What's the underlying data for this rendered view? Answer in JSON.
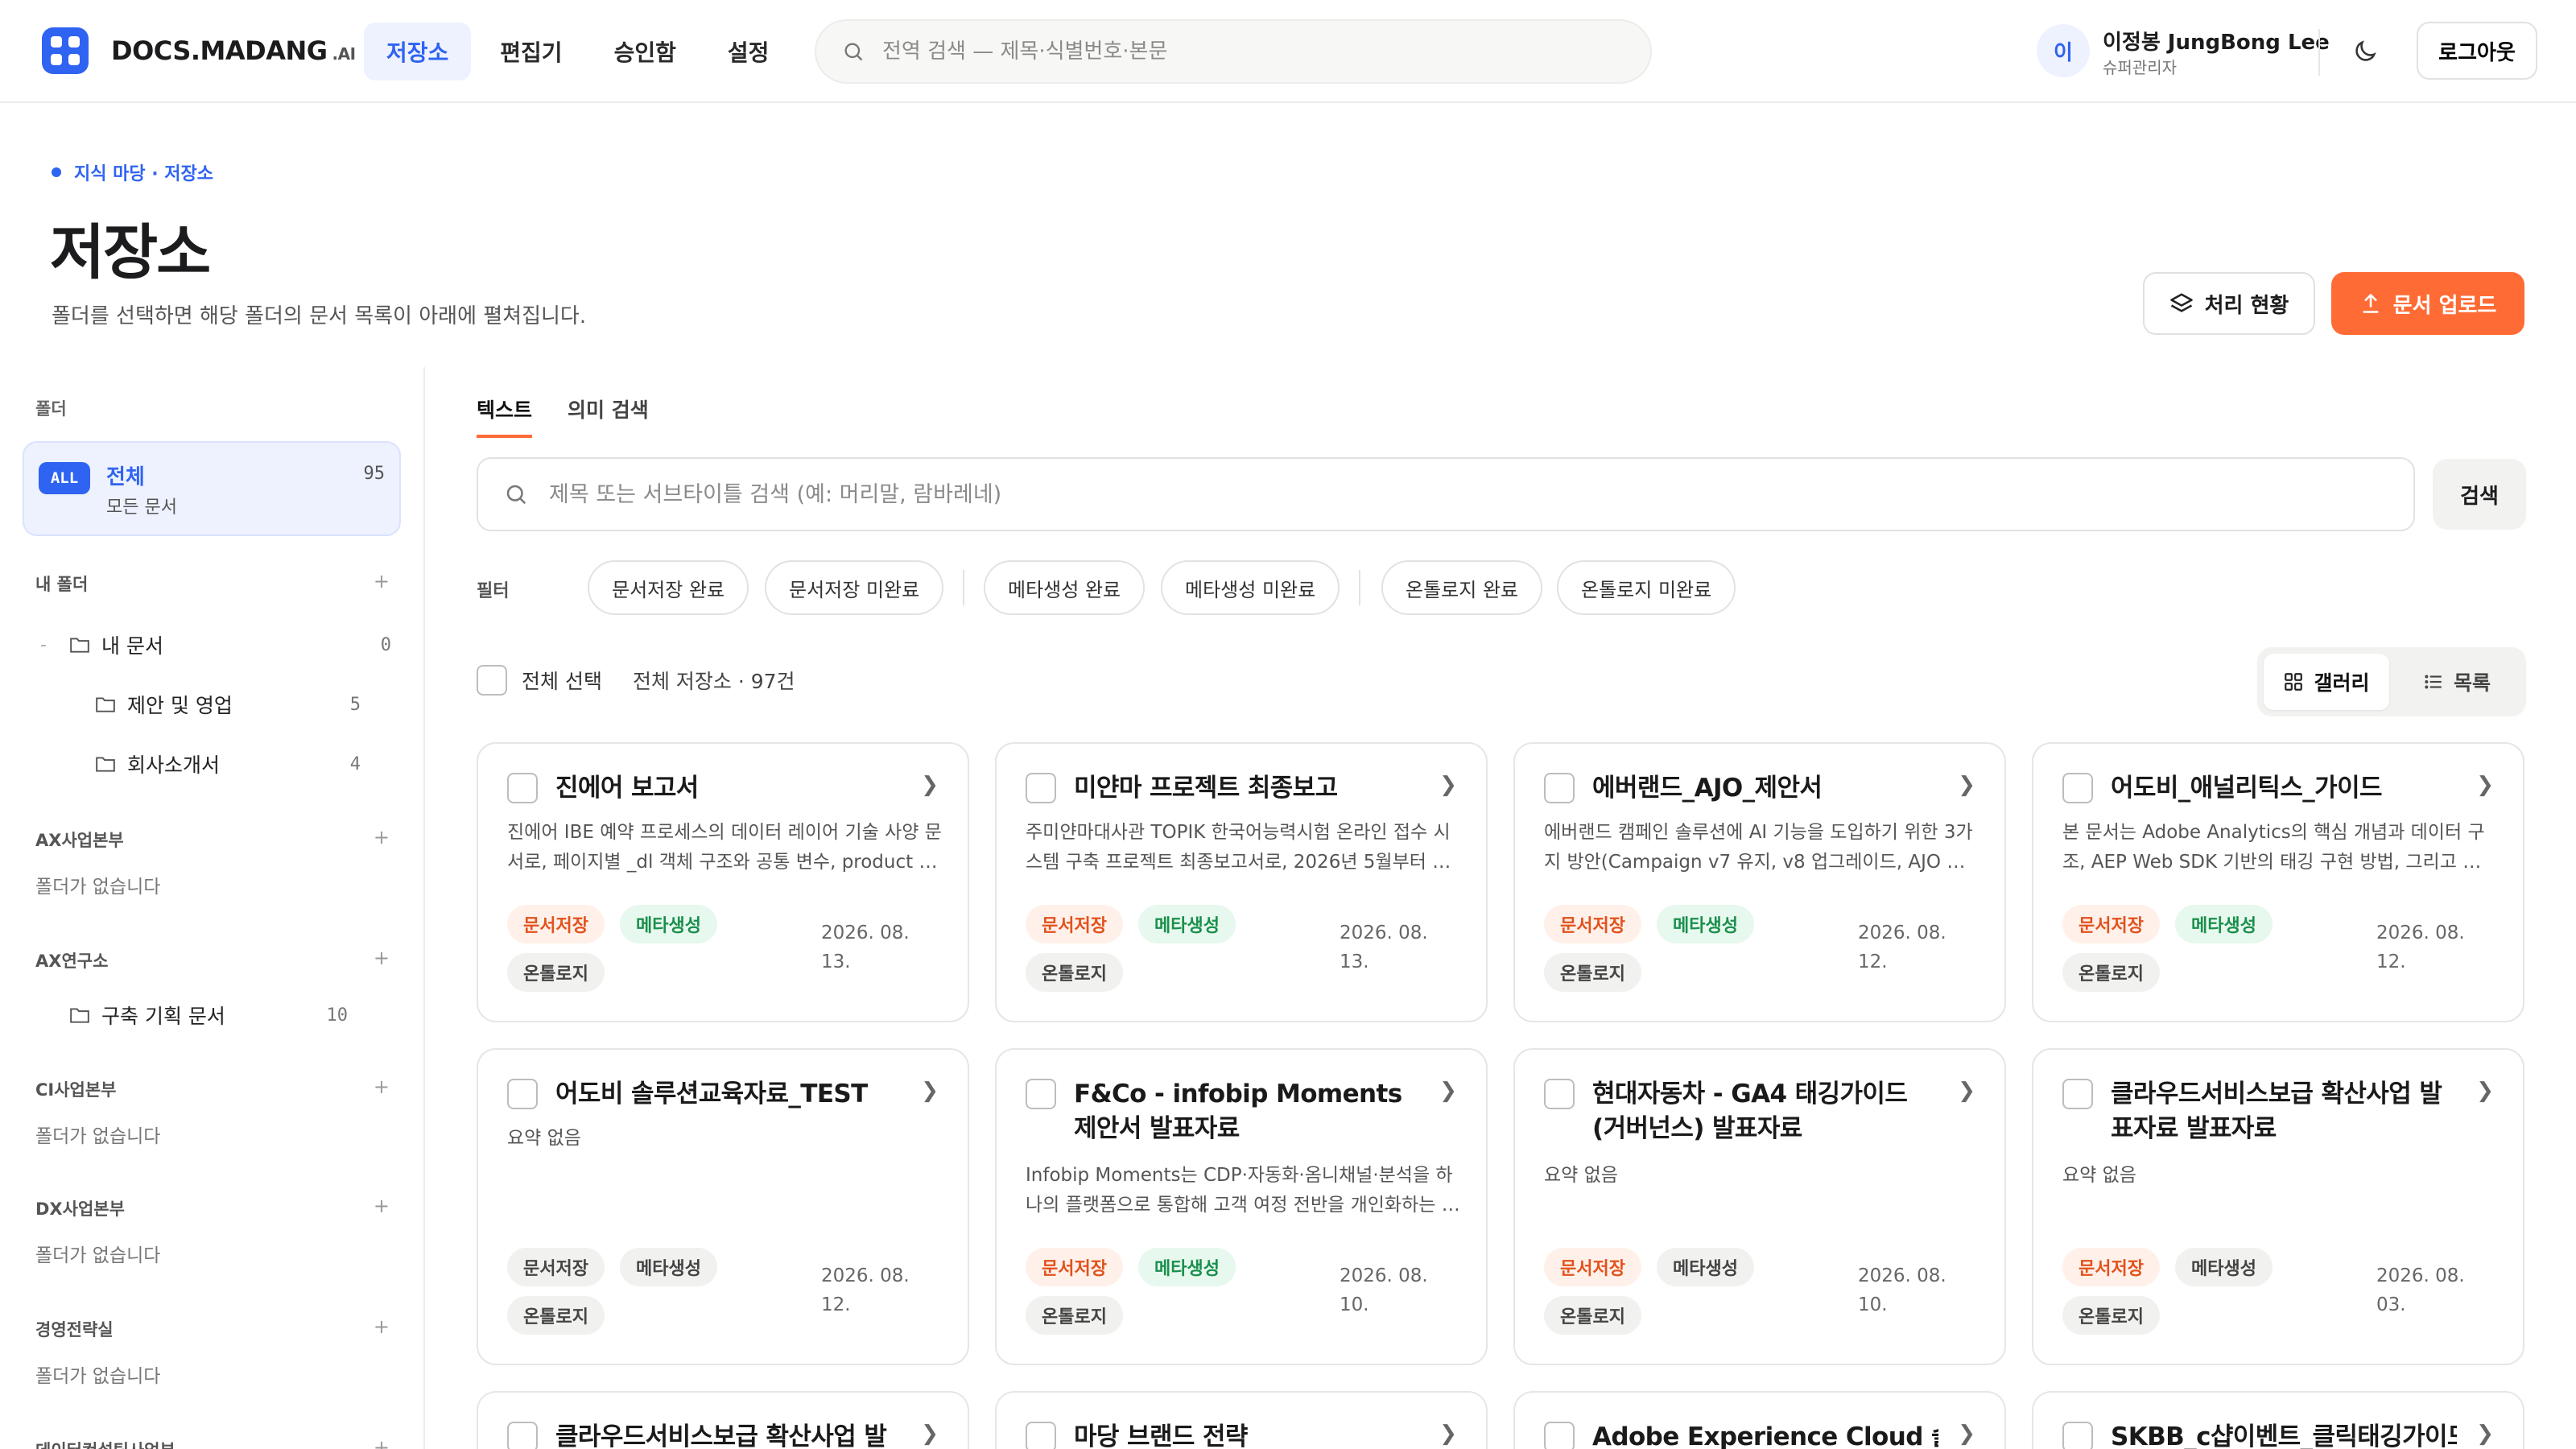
{
  "header": {
    "logo_text": "DOCS.MADANG",
    "logo_suffix": ".AI",
    "nav": [
      {
        "label": "저장소",
        "active": true
      },
      {
        "label": "편집기",
        "active": false
      },
      {
        "label": "승인함",
        "active": false
      },
      {
        "label": "설정",
        "active": false
      }
    ],
    "search_placeholder": "전역 검색 — 제목·식별번호·본문",
    "user": {
      "avatar_initial": "이",
      "name": "이정봉 JungBong Lee",
      "role": "슈퍼관리자"
    },
    "theme_icon": "moon-icon",
    "logout_label": "로그아웃"
  },
  "page": {
    "breadcrumb": "지식 마당 · 저장소",
    "title": "저장소",
    "description": "폴더를 선택하면 해당 폴더의 문서 목록이 아래에 펼쳐집니다.",
    "status_button": "처리 현황",
    "upload_button": "문서 업로드"
  },
  "sidebar": {
    "folders_label": "폴더",
    "all": {
      "badge": "ALL",
      "title": "전체",
      "subtitle": "모든 문서",
      "count": "95"
    },
    "groups": [
      {
        "name": "내 폴더",
        "add": "+"
      },
      {
        "name": "AX사업본부",
        "add": "+",
        "empty": "폴더가 없습니다"
      },
      {
        "name": "AX연구소",
        "add": "+"
      },
      {
        "name": "CI사업본부",
        "add": "+",
        "empty": "폴더가 없습니다"
      },
      {
        "name": "DX사업본부",
        "add": "+",
        "empty": "폴더가 없습니다"
      },
      {
        "name": "경영전략실",
        "add": "+",
        "empty": "폴더가 없습니다"
      },
      {
        "name": "데이터컨설팅사업부",
        "add": "+"
      }
    ],
    "tree": [
      {
        "name": "내 문서",
        "count": "0",
        "twist": "-"
      },
      {
        "name": "제안 및 영업",
        "count": "5"
      },
      {
        "name": "회사소개서",
        "count": "4"
      },
      {
        "name": "구축 기획 문서",
        "count": "10"
      }
    ]
  },
  "main": {
    "tabs": [
      {
        "label": "텍스트",
        "active": true
      },
      {
        "label": "의미 검색",
        "active": false
      }
    ],
    "search_placeholder": "제목 또는 서브타이틀 검색 (예: 머리말, 람바레네)",
    "search_button": "검색",
    "filter_label": "필터",
    "filters": [
      "문서저장 완료",
      "문서저장 미완료",
      "메타생성 완료",
      "메타생성 미완료",
      "온톨로지 완료",
      "온톨로지 미완료"
    ],
    "select_all_label": "전체 선택",
    "summary_info": "전체 저장소 · 97건",
    "view_gallery": "갤러리",
    "view_list": "목록"
  },
  "cards": [
    {
      "title": "진에어 보고서",
      "summary": "진에어 IBE 예약 프로세스의 데이터 레이어 기술 사양 문서로, 페이지별 _dl 객체 구조와 공통 변수, product 변수 등을 정의합니다.",
      "tags": [
        {
          "label": "문서저장",
          "style": "orange"
        },
        {
          "label": "메타생성",
          "style": "green"
        },
        {
          "label": "온톨로지",
          "style": "gray"
        }
      ],
      "date": "2026. 08. 13."
    },
    {
      "title": "미얀마 프로젝트 최종보고",
      "summary": "주미얀마대사관 TOPIK 한국어능력시험 온라인 접수 시스템 구축 프로젝트 최종보고서로, 2026년 5월부터 진행된 내용을 정리합니다.",
      "tags": [
        {
          "label": "문서저장",
          "style": "orange"
        },
        {
          "label": "메타생성",
          "style": "green"
        },
        {
          "label": "온톨로지",
          "style": "gray"
        }
      ],
      "date": "2026. 08. 13."
    },
    {
      "title": "에버랜드_AJO_제안서",
      "summary": "에버랜드 캠페인 솔루션에 AI 기능을 도입하기 위한 3가지 방안(Campaign v7 유지, v8 업그레이드, AJO 전환)을 제안합니다.",
      "tags": [
        {
          "label": "문서저장",
          "style": "orange"
        },
        {
          "label": "메타생성",
          "style": "green"
        },
        {
          "label": "온톨로지",
          "style": "gray"
        }
      ],
      "date": "2026. 08. 12."
    },
    {
      "title": "어도비_애널리틱스_가이드",
      "summary": "본 문서는 Adobe Analytics의 핵심 개념과 데이터 구조, AEP Web SDK 기반의 태깅 구현 방법, 그리고 활용 사례를 설명합니다.",
      "tags": [
        {
          "label": "문서저장",
          "style": "orange"
        },
        {
          "label": "메타생성",
          "style": "green"
        },
        {
          "label": "온톨로지",
          "style": "gray"
        }
      ],
      "date": "2026. 08. 12."
    },
    {
      "title": "어도비 솔루션교육자료_TEST",
      "summary": "요약 없음",
      "tags": [
        {
          "label": "문서저장",
          "style": "gray"
        },
        {
          "label": "메타생성",
          "style": "gray"
        },
        {
          "label": "온톨로지",
          "style": "gray"
        }
      ],
      "date": "2026. 08. 12."
    },
    {
      "title": "F&Co - infobip Moments 제안서 발표자료",
      "summary": "Infobip Moments는 CDP·자동화·옴니채널·분석을 하나의 플랫폼으로 통합해 고객 여정 전반을 개인화하는 솔루션입니다.",
      "tags": [
        {
          "label": "문서저장",
          "style": "orange"
        },
        {
          "label": "메타생성",
          "style": "green"
        },
        {
          "label": "온톨로지",
          "style": "gray"
        }
      ],
      "date": "2026. 08. 10."
    },
    {
      "title": "현대자동차 - GA4 태깅가이드 (거버넌스) 발표자료",
      "summary": "요약 없음",
      "tags": [
        {
          "label": "문서저장",
          "style": "orange"
        },
        {
          "label": "메타생성",
          "style": "gray"
        },
        {
          "label": "온톨로지",
          "style": "gray"
        }
      ],
      "date": "2026. 08. 10."
    },
    {
      "title": "클라우드서비스보급 확산사업 발표자료 발표자료",
      "summary": "요약 없음",
      "tags": [
        {
          "label": "문서저장",
          "style": "orange"
        },
        {
          "label": "메타생성",
          "style": "gray"
        },
        {
          "label": "온톨로지",
          "style": "gray"
        }
      ],
      "date": "2026. 08. 03."
    },
    {
      "title": "클라우드서비스보급 확산사업 발",
      "summary": "",
      "tags": [],
      "date": ""
    },
    {
      "title": "마당 브랜드 전략",
      "summary": "",
      "tags": [],
      "date": ""
    },
    {
      "title": "Adobe Experience Cloud 솔루",
      "summary": "",
      "tags": [],
      "date": ""
    },
    {
      "title": "SKBB_c샵이벤트_클릭태깅가이드",
      "summary": "",
      "tags": [],
      "date": ""
    }
  ]
}
